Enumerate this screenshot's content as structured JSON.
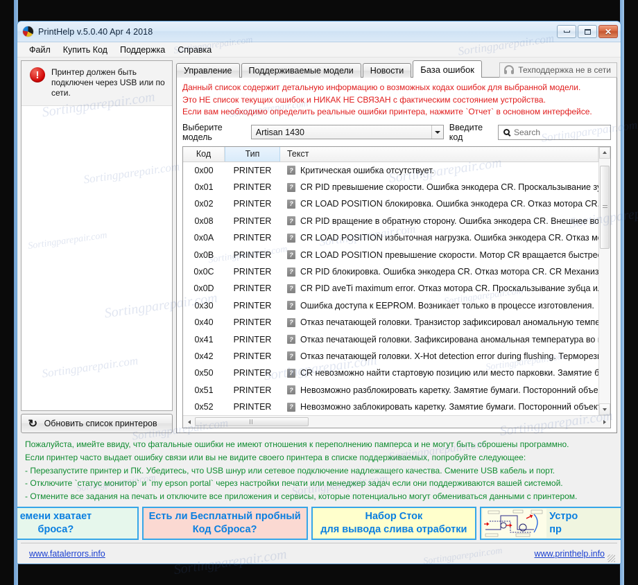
{
  "window": {
    "title": "PrintHelp v.5.0.40 Apr  4 2018",
    "logo_icon": "printhelp-logo",
    "minimize_label": "Minimize",
    "maximize_label": "Maximize",
    "close_label": "✕"
  },
  "menu": [
    "Файл",
    "Купить Код",
    "Поддержка",
    "Справка"
  ],
  "left_panel": {
    "warning_icon": "!",
    "warning_text": "Принтер должен быть подключен через USB или по сети.",
    "refresh_icon": "↻",
    "refresh_label": "Обновить список принтеров"
  },
  "tabs": [
    {
      "label": "Управление",
      "active": false
    },
    {
      "label": "Поддерживаемые модели",
      "active": false
    },
    {
      "label": "Новости",
      "active": false
    },
    {
      "label": "База ошибок",
      "active": true
    }
  ],
  "support_status": {
    "icon": "headset-icon",
    "label": "Техподдержка не в сети"
  },
  "notice": [
    "Данный список содержит детальную информацию о возможных кодах ошибок для выбранной модели.",
    "Это НЕ список текущих ошибок и НИКАК НЕ СВЯЗАН с фактическим состоянием устройства.",
    "Если вам необходимо определить реальные ошибки принтера, нажмите `Отчет` в основном интерфейсе."
  ],
  "notice_color": "#e01b1b",
  "controls": {
    "model_label": "Выберите модель",
    "model_value": "Artisan 1430",
    "code_label": "Введите код",
    "search_placeholder": "Search",
    "search_value": ""
  },
  "table": {
    "columns": [
      "Код",
      "Тип",
      "Текст"
    ],
    "rows": [
      {
        "code": "0x00",
        "type": "PRINTER",
        "text": "Критическая ошибка отсутствует."
      },
      {
        "code": "0x01",
        "type": "PRINTER",
        "text": "CR PID превышение скорости. Ошибка энкодера CR. Проскальзывание зубца"
      },
      {
        "code": "0x02",
        "type": "PRINTER",
        "text": "CR LOAD POSITION блокировка. Ошибка энкодера CR. Отказ мотора CR. Каре"
      },
      {
        "code": "0x08",
        "type": "PRINTER",
        "text": "CR PID вращение в обратную сторону. Ошибка энкодера CR. Внешнее воздей"
      },
      {
        "code": "0x0A",
        "type": "PRINTER",
        "text": "CR LOAD POSITION избыточная нагрузка. Ошибка энкодера CR. Отказ мотора"
      },
      {
        "code": "0x0B",
        "type": "PRINTER",
        "text": "CR LOAD POSITION превышение скорости. Мотор CR вращается быстрее ожи"
      },
      {
        "code": "0x0C",
        "type": "PRINTER",
        "text": "CR PID блокировка. Ошибка энкодера CR. Отказ мотора CR. CR Механизм пер"
      },
      {
        "code": "0x0D",
        "type": "PRINTER",
        "text": "CR PID aveTi maximum error. Отказ мотора CR. Проскальзывание зубца или не"
      },
      {
        "code": "0x30",
        "type": "PRINTER",
        "text": "Ошибка доступа к EEPROM. Возникает только в процессе изготовления."
      },
      {
        "code": "0x40",
        "type": "PRINTER",
        "text": "Отказ печатающей головки. Транзистор зафиксировал аномальную температ"
      },
      {
        "code": "0x41",
        "type": "PRINTER",
        "text": "Отказ печатающей головки. Зафиксирована аномальная температура во врем"
      },
      {
        "code": "0x42",
        "type": "PRINTER",
        "text": "Отказ печатающей головки. X-Hot detection error during flushing. Терморезис"
      },
      {
        "code": "0x50",
        "type": "PRINTER",
        "text": "CR невозможно найти стартовую позицию или место парковки. Замятие бум"
      },
      {
        "code": "0x51",
        "type": "PRINTER",
        "text": "Невозможно разблокировать каретку. Замятие бумаги. Посторонний объект."
      },
      {
        "code": "0x52",
        "type": "PRINTER",
        "text": "Невозможно заблокировать каретку. Замятие бумаги. Посторонний объект. Д"
      }
    ],
    "row_icon": "missing-image-placeholder",
    "row_icon_glyph": "?"
  },
  "tips": {
    "color": "#0e8b2f",
    "lines": [
      "Пожалуйста, имейте ввиду, что фатальные ошибки не имеют отношения к переполнению памперса и не могут быть сброшены программно.",
      "Если принтер часто выдает ошибку связи или вы не видите своего принтера в списке поддерживаемых, попробуйте следующее:",
      "- Перезапустите принтер и ПК. Убедитесь, что USB шнур или сетевое подключение надлежащего качества. Смените USB кабель и порт.",
      "- Отключите `статус монитор` и `my epson portal` через настройки печати или менеджер задач если они поддерживаются вашей системой.",
      "- Отмените все задания на печать и отключите все приложения и сервисы, которые потенциально могут обмениваться данными с принтером."
    ]
  },
  "banners": [
    {
      "line1": "емени хватает",
      "line2": "броса?",
      "bg": "#e6f7ec",
      "border": "#36a6e8",
      "text_color": "#0a7fe0"
    },
    {
      "line1": "Есть ли Бесплатный пробный",
      "line2": "Код Сброса?",
      "bg": "#fbd9d2",
      "border": "#36a6e8",
      "text_color": "#0a7fe0"
    },
    {
      "line1": "Набор Сток",
      "line2": "для вывода слива отработки",
      "bg": "#ffffcc",
      "border": "#36a6e8",
      "text_color": "#0a7fe0"
    },
    {
      "line1": "Устро",
      "line2": "пр",
      "bg": "#f0f5e0",
      "border": "#36a6e8",
      "text_color": "#0a7fe0",
      "has_diagram": true
    }
  ],
  "links": {
    "left": "www.fatalerrors.info",
    "right": "www.printhelp.info"
  },
  "watermark": "Sortingparepair.com"
}
